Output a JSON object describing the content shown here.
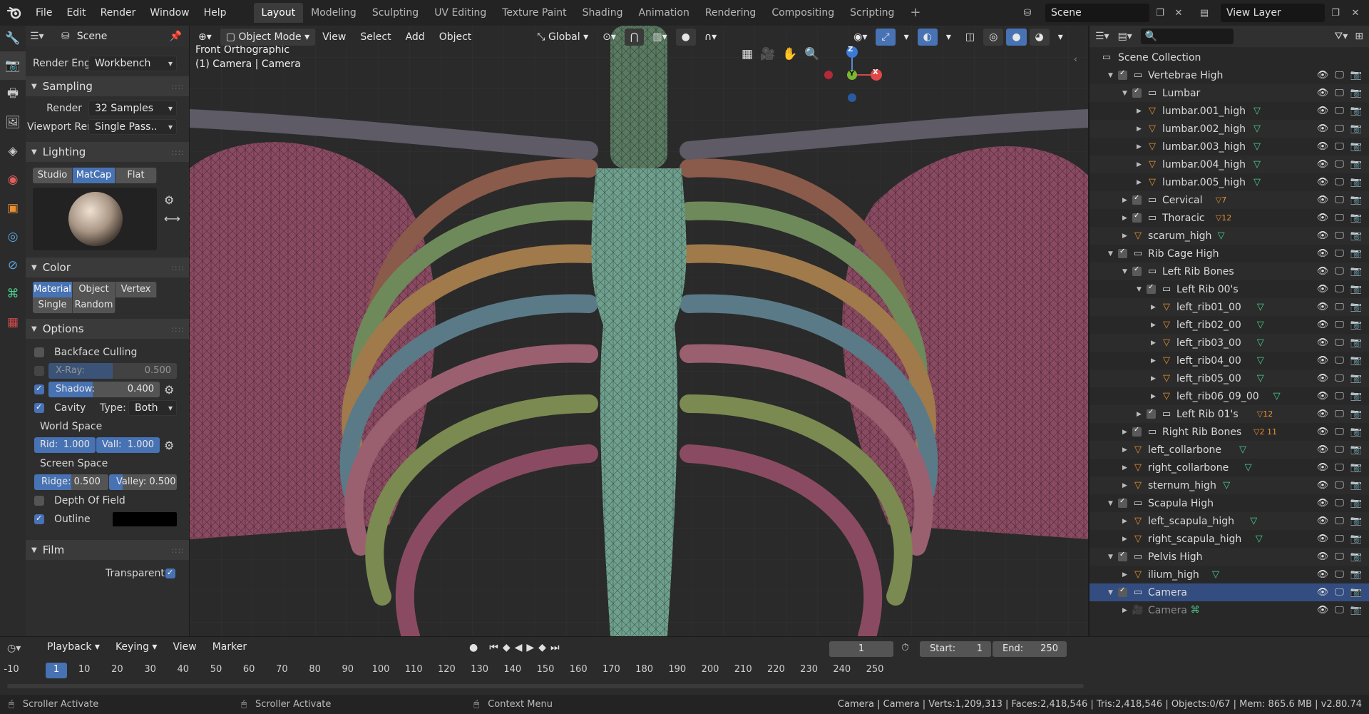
{
  "topbar": {
    "menus": [
      "File",
      "Edit",
      "Render",
      "Window",
      "Help"
    ],
    "workspaces": [
      "Layout",
      "Modeling",
      "Sculpting",
      "UV Editing",
      "Texture Paint",
      "Shading",
      "Animation",
      "Rendering",
      "Compositing",
      "Scripting"
    ],
    "active_workspace": "Layout",
    "add_tab": "+",
    "scene_name": "Scene",
    "view_layer": "View Layer"
  },
  "properties": {
    "scene_label": "Scene",
    "render_engine_label": "Render Engine",
    "render_engine_value": "Workbench",
    "sections": {
      "sampling": "Sampling",
      "lighting": "Lighting",
      "color": "Color",
      "options": "Options",
      "film": "Film"
    },
    "sampling": {
      "render_label": "Render",
      "render_value": "32 Samples",
      "viewport_label": "Viewport Ren..",
      "viewport_value": "Single Pass.."
    },
    "lighting_modes": [
      "Studio",
      "MatCap",
      "Flat"
    ],
    "lighting_active": "MatCap",
    "color_modes_row1": [
      "Material",
      "Object",
      "Vertex"
    ],
    "color_modes_row2": [
      "Single",
      "Random"
    ],
    "color_active": "Material",
    "options": {
      "backface": "Backface Culling",
      "xray_label": "X-Ray:",
      "xray_value": "0.500",
      "xray_fraction": 0.5,
      "shadow_label": "Shadow:",
      "shadow_value": "0.400",
      "shadow_fraction": 0.4,
      "cavity": "Cavity",
      "type_label": "Type:",
      "type_value": "Both",
      "world_space": "World Space",
      "ridge_ws_label": "Rid:",
      "ridge_ws_value": "1.000",
      "valley_ws_label": "Vall:",
      "valley_ws_value": "1.000",
      "screen_space": "Screen Space",
      "ridge_ss": "Ridge: 0.500",
      "valley_ss": "Valley: 0.500",
      "dof": "Depth Of Field",
      "outline": "Outline"
    },
    "film": {
      "transparent": "Transparent"
    }
  },
  "viewport": {
    "mode": "Object Mode",
    "menus": [
      "View",
      "Select",
      "Add",
      "Object"
    ],
    "orientation": "Global",
    "overlay_title": "Front Orthographic",
    "overlay_sub": "(1) Camera | Camera",
    "axes": {
      "z": "Z",
      "y": "Y",
      "x": "X"
    }
  },
  "outliner": {
    "search_placeholder": "",
    "root": "Scene Collection",
    "rows": [
      {
        "text": "Vertebrae High",
        "type": "collection",
        "depth": 1,
        "tri": "▼",
        "cb": true
      },
      {
        "text": "Lumbar",
        "type": "collection",
        "depth": 2,
        "tri": "▼",
        "cb": true
      },
      {
        "text": "lumbar.001_high",
        "type": "mesh",
        "depth": 3,
        "tri": "▶"
      },
      {
        "text": "lumbar.002_high",
        "type": "mesh",
        "depth": 3,
        "tri": "▶"
      },
      {
        "text": "lumbar.003_high",
        "type": "mesh",
        "depth": 3,
        "tri": "▶"
      },
      {
        "text": "lumbar.004_high",
        "type": "mesh",
        "depth": 3,
        "tri": "▶"
      },
      {
        "text": "lumbar.005_high",
        "type": "mesh",
        "depth": 3,
        "tri": "▶"
      },
      {
        "text": "Cervical",
        "type": "collection",
        "depth": 2,
        "tri": "▶",
        "cb": true,
        "badge": "7"
      },
      {
        "text": "Thoracic",
        "type": "collection",
        "depth": 2,
        "tri": "▶",
        "cb": true,
        "badge": "12"
      },
      {
        "text": "scarum_high",
        "type": "mesh",
        "depth": 2,
        "tri": "▶"
      },
      {
        "text": "Rib Cage High",
        "type": "collection",
        "depth": 1,
        "tri": "▼",
        "cb": true
      },
      {
        "text": "Left Rib Bones",
        "type": "collection",
        "depth": 2,
        "tri": "▼",
        "cb": true
      },
      {
        "text": "Left Rib 00's",
        "type": "collection",
        "depth": 3,
        "tri": "▼",
        "cb": true
      },
      {
        "text": "left_rib01_00",
        "type": "mesh",
        "depth": 4,
        "tri": "▶"
      },
      {
        "text": "left_rib02_00",
        "type": "mesh",
        "depth": 4,
        "tri": "▶"
      },
      {
        "text": "left_rib03_00",
        "type": "mesh",
        "depth": 4,
        "tri": "▶"
      },
      {
        "text": "left_rib04_00",
        "type": "mesh",
        "depth": 4,
        "tri": "▶"
      },
      {
        "text": "left_rib05_00",
        "type": "mesh",
        "depth": 4,
        "tri": "▶"
      },
      {
        "text": "left_rib06_09_00",
        "type": "mesh",
        "depth": 4,
        "tri": "▶"
      },
      {
        "text": "Left Rib 01's",
        "type": "collection",
        "depth": 3,
        "tri": "▶",
        "cb": true,
        "badge": "12"
      },
      {
        "text": "Right Rib Bones",
        "type": "collection",
        "depth": 2,
        "tri": "▶",
        "cb": true,
        "badge": "2 11"
      },
      {
        "text": "left_collarbone",
        "type": "mesh",
        "depth": 2,
        "tri": "▶"
      },
      {
        "text": "right_collarbone",
        "type": "mesh",
        "depth": 2,
        "tri": "▶"
      },
      {
        "text": "sternum_high",
        "type": "mesh",
        "depth": 2,
        "tri": "▶"
      },
      {
        "text": "Scapula High",
        "type": "collection",
        "depth": 1,
        "tri": "▼",
        "cb": true
      },
      {
        "text": "left_scapula_high",
        "type": "mesh",
        "depth": 2,
        "tri": "▶"
      },
      {
        "text": "right_scapula_high",
        "type": "mesh",
        "depth": 2,
        "tri": "▶"
      },
      {
        "text": "Pelvis High",
        "type": "collection",
        "depth": 1,
        "tri": "▼",
        "cb": true
      },
      {
        "text": "ilium_high",
        "type": "mesh",
        "depth": 2,
        "tri": "▶"
      },
      {
        "text": "Camera",
        "type": "collection",
        "depth": 1,
        "tri": "▼",
        "cb": true,
        "sel": true
      },
      {
        "text": "Camera",
        "type": "camera",
        "depth": 2,
        "tri": "▶"
      }
    ]
  },
  "timeline": {
    "menus": [
      "Playback",
      "Keying",
      "View",
      "Marker"
    ],
    "current_frame": "1",
    "start_label": "Start:",
    "start_value": "1",
    "end_label": "End:",
    "end_value": "250",
    "ticks": [
      "-10",
      "1",
      "10",
      "20",
      "30",
      "40",
      "50",
      "60",
      "70",
      "80",
      "90",
      "100",
      "110",
      "120",
      "130",
      "140",
      "150",
      "160",
      "170",
      "180",
      "190",
      "200",
      "210",
      "220",
      "230",
      "240",
      "250"
    ]
  },
  "statusbar": {
    "hint1": "Scroller Activate",
    "hint2": "Scroller Activate",
    "hint3": "Context Menu",
    "stats": "Camera | Camera | Verts:1,209,313 | Faces:2,418,546 | Tris:2,418,546 | Objects:0/67 | Mem: 865.6 MB | v2.80.74"
  },
  "colors": {
    "accent": "#4772b3",
    "mesh_icon": "#4bd08f",
    "object_icon": "#e8912f",
    "selected_row": "#334d80"
  }
}
